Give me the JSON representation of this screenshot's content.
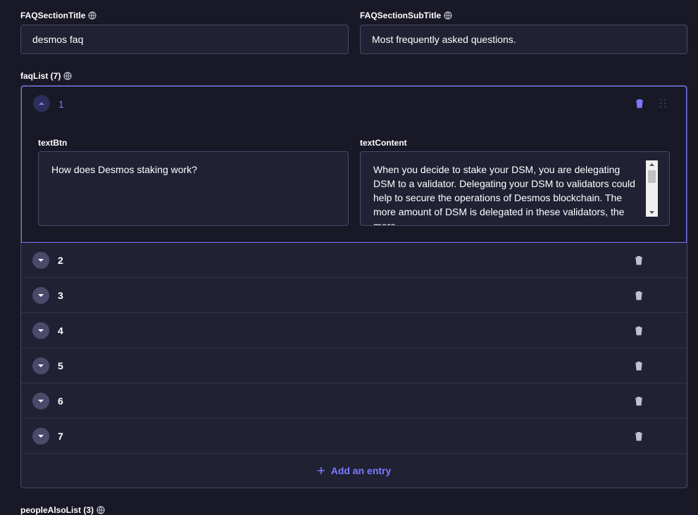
{
  "fields": {
    "title": {
      "label": "FAQSectionTitle",
      "value": "desmos faq"
    },
    "subtitle": {
      "label": "FAQSectionSubTitle",
      "value": "Most frequently asked questions."
    }
  },
  "faq_list": {
    "label": "faqList (7)",
    "open_item": {
      "number": "1",
      "text_btn_label": "textBtn",
      "text_btn_value": "How does Desmos staking work?",
      "text_content_label": "textContent",
      "text_content_value": "When you decide to stake your DSM, you are delegating DSM to a validator. Delegating your DSM to validators could help to secure the operations of Desmos blockchain. The more amount of DSM is delegated in these validators, the more"
    },
    "items": [
      "2",
      "3",
      "4",
      "5",
      "6",
      "7"
    ],
    "add_label": "Add an entry"
  },
  "next_section": {
    "label": "peopleAlsoList (3)"
  },
  "colors": {
    "accent": "#7b79ff",
    "background": "#181826",
    "border": "#4a4a6a"
  },
  "icons": [
    "globe-icon",
    "chevron-up-icon",
    "chevron-down-icon",
    "trash-icon",
    "drag-icon",
    "plus-icon"
  ]
}
